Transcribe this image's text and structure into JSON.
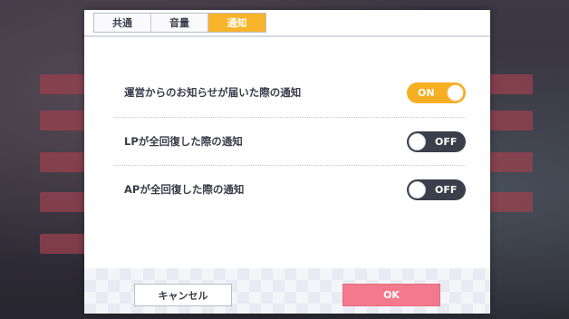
{
  "tabs": [
    {
      "label": "共通",
      "active": false
    },
    {
      "label": "音量",
      "active": false
    },
    {
      "label": "通知",
      "active": true
    }
  ],
  "settings": [
    {
      "label": "運営からのお知らせが届いた際の通知",
      "state": "ON"
    },
    {
      "label": "LPが全回復した際の通知",
      "state": "OFF"
    },
    {
      "label": "APが全回復した際の通知",
      "state": "OFF"
    }
  ],
  "buttons": {
    "cancel": "キャンセル",
    "ok": "OK"
  },
  "colors": {
    "accent": "#f8b42a",
    "toggle_on": "#f6ae22",
    "toggle_off": "#3b3e4b",
    "ok_button": "#f27a8c"
  }
}
